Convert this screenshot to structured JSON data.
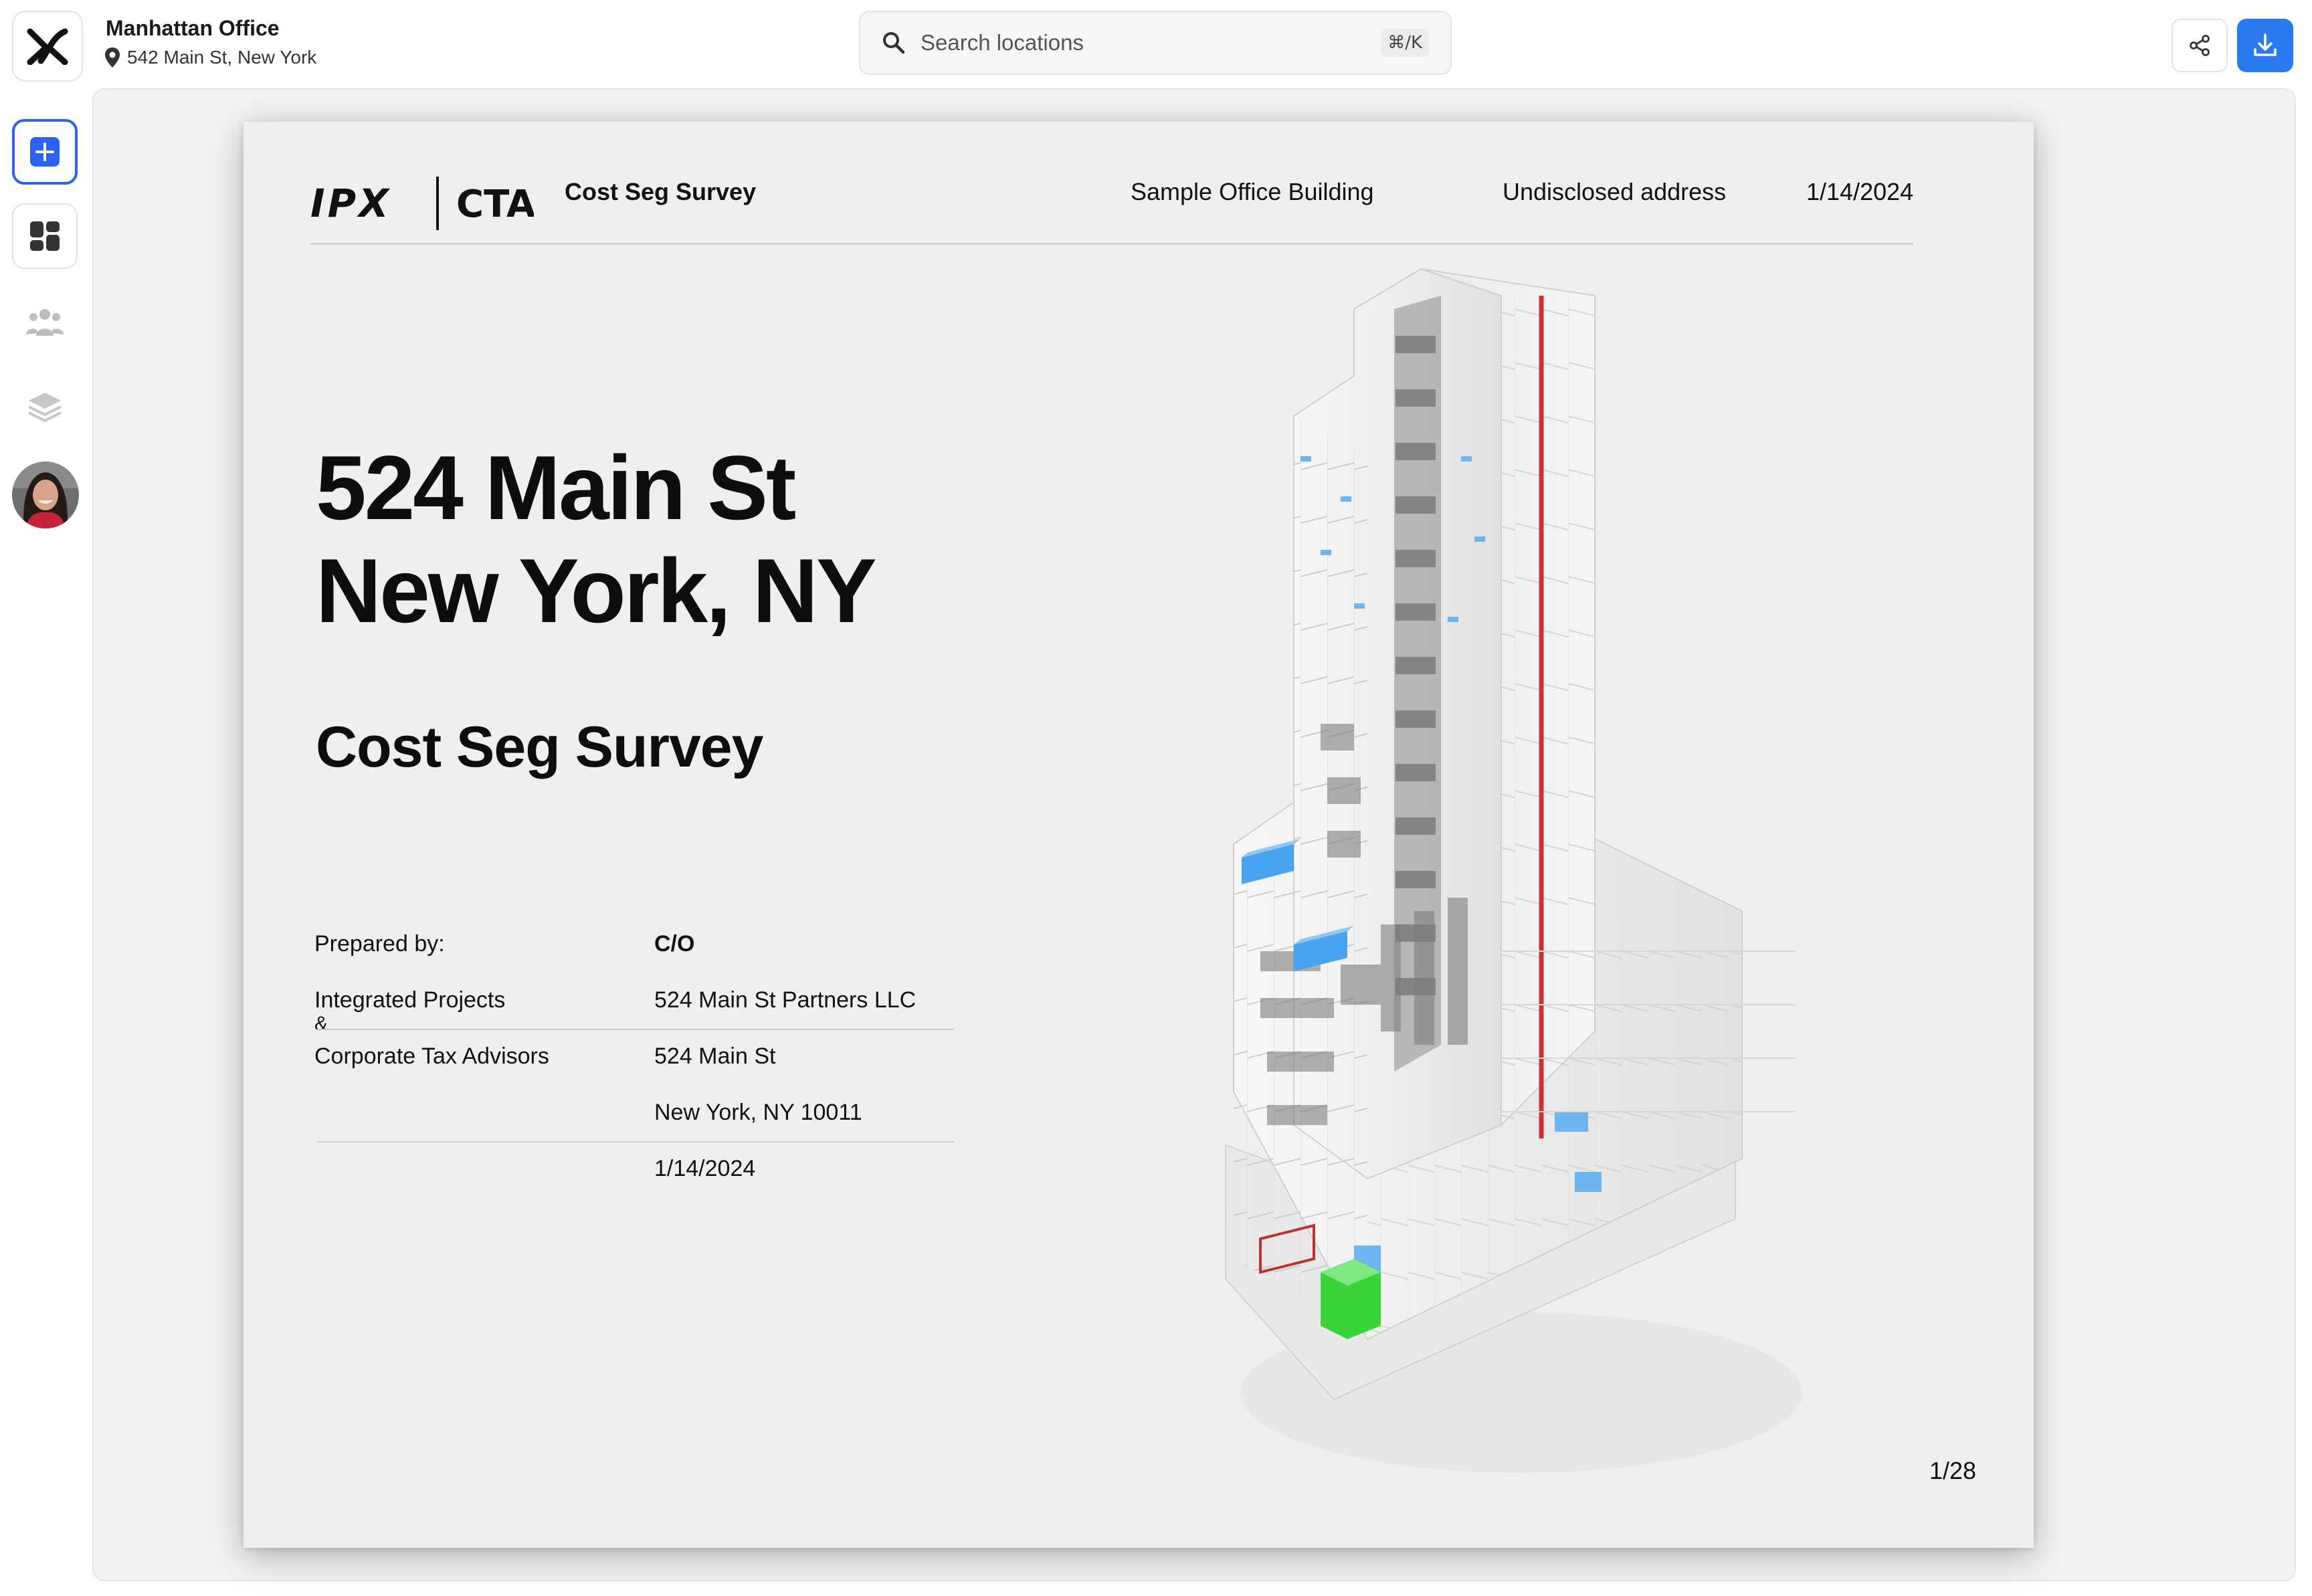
{
  "app": {
    "project_title": "Manhattan Office",
    "project_address": "542 Main St, New York"
  },
  "search": {
    "placeholder": "Search locations",
    "shortcut": "⌘/K"
  },
  "icons": {
    "app_logo": "x-logo-icon",
    "location": "map-pin-icon",
    "search": "search-icon",
    "share": "share-icon",
    "download": "download-icon",
    "new": "plus-icon",
    "dashboard": "dashboard-icon",
    "team": "team-icon",
    "layers": "layers-icon"
  },
  "colors": {
    "accent": "#2b62ee",
    "download_button": "#2b7bf0",
    "slide_background": "#efefef",
    "model_blue": "#4aa3ee",
    "model_green": "#3ad43a",
    "model_red": "#d03030"
  },
  "slide": {
    "brand_left": "IPX",
    "brand_right": "CTA",
    "doc_label": "Cost Seg Survey",
    "header_building": "Sample Office Building",
    "header_address": "Undisclosed address",
    "header_date": "1/14/2024",
    "title_line1": "524 Main St",
    "title_line2": "New York, NY",
    "survey_title": "Cost Seg Survey",
    "prepared_by_label": "Prepared by:",
    "preparer_line1": "Integrated Projects",
    "preparer_line2": "&",
    "preparer_line3": "Corporate Tax Advisors",
    "co_label": "C/O",
    "client_name": "524 Main St Partners LLC",
    "client_street": "524 Main St",
    "client_city": "New York, NY 10011",
    "report_date": "1/14/2024",
    "page_indicator": "1/28"
  }
}
